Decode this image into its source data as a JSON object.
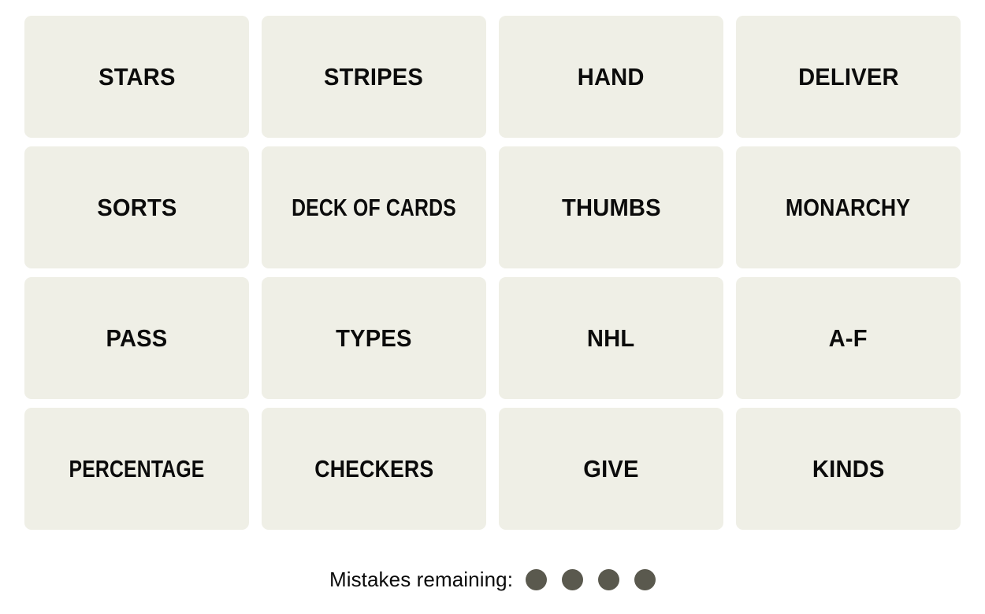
{
  "board": {
    "columns": 4,
    "rows": 4,
    "tile_color": "#EFEFE6",
    "text_color": "#0B0B0B",
    "background_color": "#FFFFFF",
    "tiles": [
      {
        "label": "STARS",
        "row": 1,
        "col": 1,
        "selected": false
      },
      {
        "label": "STRIPES",
        "row": 1,
        "col": 2,
        "selected": false
      },
      {
        "label": "HAND",
        "row": 1,
        "col": 3,
        "selected": false
      },
      {
        "label": "DELIVER",
        "row": 1,
        "col": 4,
        "selected": false
      },
      {
        "label": "SORTS",
        "row": 2,
        "col": 1,
        "selected": false
      },
      {
        "label": "DECK OF CARDS",
        "row": 2,
        "col": 2,
        "selected": false
      },
      {
        "label": "THUMBS",
        "row": 2,
        "col": 3,
        "selected": false
      },
      {
        "label": "MONARCHY",
        "row": 2,
        "col": 4,
        "selected": false
      },
      {
        "label": "PASS",
        "row": 3,
        "col": 1,
        "selected": false
      },
      {
        "label": "TYPES",
        "row": 3,
        "col": 2,
        "selected": false
      },
      {
        "label": "NHL",
        "row": 3,
        "col": 3,
        "selected": false
      },
      {
        "label": "A-F",
        "row": 3,
        "col": 4,
        "selected": false
      },
      {
        "label": "PERCENTAGE",
        "row": 4,
        "col": 1,
        "selected": false
      },
      {
        "label": "CHECKERS",
        "row": 4,
        "col": 2,
        "selected": false
      },
      {
        "label": "GIVE",
        "row": 4,
        "col": 3,
        "selected": false
      },
      {
        "label": "KINDS",
        "row": 4,
        "col": 4,
        "selected": false
      }
    ]
  },
  "mistakes": {
    "label": "Mistakes remaining:",
    "remaining": 4,
    "total": 4,
    "dot_color": "#5A594E"
  }
}
